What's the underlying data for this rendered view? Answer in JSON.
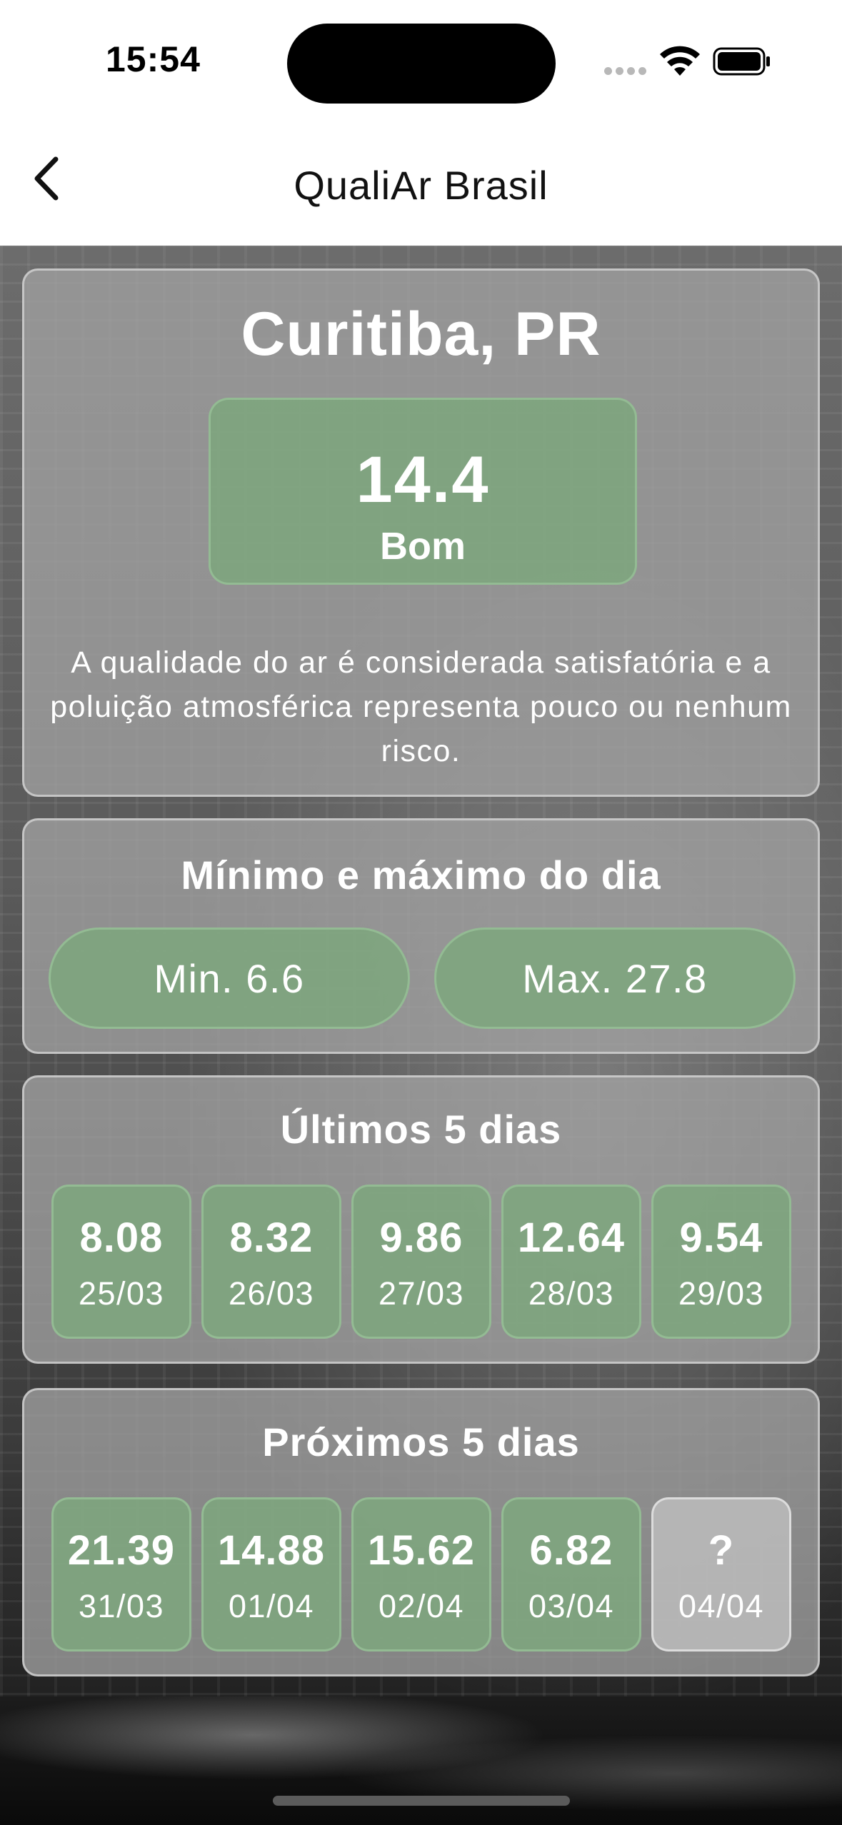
{
  "status_bar": {
    "time": "15:54"
  },
  "nav": {
    "title": "QualiAr Brasil",
    "back_icon": "chevron-left-icon"
  },
  "main": {
    "city": "Curitiba, PR",
    "aqi_value": "14.4",
    "aqi_label": "Bom",
    "description": "A qualidade do ar é considerada satisfatória e a poluição atmosférica representa pouco ou nenhum risco."
  },
  "minmax": {
    "title": "Mínimo e máximo do dia",
    "min": "Min. 6.6",
    "max": "Max. 27.8"
  },
  "past": {
    "title": "Últimos 5 dias",
    "days": [
      {
        "value": "8.08",
        "date": "25/03"
      },
      {
        "value": "8.32",
        "date": "26/03"
      },
      {
        "value": "9.86",
        "date": "27/03"
      },
      {
        "value": "12.64",
        "date": "28/03"
      },
      {
        "value": "9.54",
        "date": "29/03"
      }
    ]
  },
  "next": {
    "title": "Próximos 5 dias",
    "days": [
      {
        "value": "21.39",
        "date": "31/03"
      },
      {
        "value": "14.88",
        "date": "01/04"
      },
      {
        "value": "15.62",
        "date": "02/04"
      },
      {
        "value": "6.82",
        "date": "03/04"
      },
      {
        "value": "?",
        "date": "04/04"
      }
    ]
  },
  "colors": {
    "good_green": "#7ea57e",
    "unknown_gray": "#b9b9b9",
    "card_bg": "#a0a0a0"
  }
}
